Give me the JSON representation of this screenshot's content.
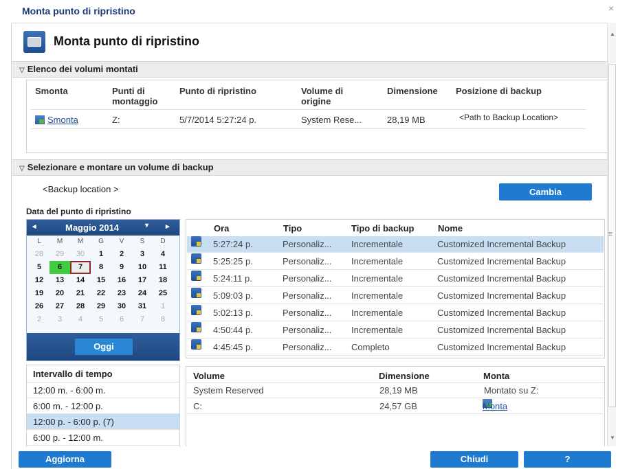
{
  "window": {
    "title": "Monta punto di ripristino",
    "close_glyph": "×"
  },
  "header": {
    "title": "Monta punto di ripristino",
    "icon": "mount-disk-icon"
  },
  "mounted_section": {
    "title": "Elenco dei volumi montati",
    "columns": [
      "Smonta",
      "Punti di\nmontaggio",
      "Punto di ripristino",
      "Volume di\norigine",
      "Dimensione",
      "Posizione di backup"
    ],
    "row": {
      "smonta": "Smonta",
      "mount_point": "Z:",
      "restore_point": "5/7/2014 5:27:24 p.",
      "source_volume": "System Rese...",
      "size": "28,19 MB",
      "backup_location": "<Path to Backup Location>"
    }
  },
  "select_section": {
    "title": "Selezionare e montare un volume di backup",
    "backup_location": "<Backup location >",
    "change_button": "Cambia",
    "date_label": "Data del punto di ripristino"
  },
  "calendar": {
    "month": "Maggio 2014",
    "prev": "◂",
    "next": "▸",
    "dropdown": "▾",
    "dow": [
      "L",
      "M",
      "M",
      "G",
      "V",
      "S",
      "D"
    ],
    "weeks": [
      [
        {
          "d": "28",
          "o": true
        },
        {
          "d": "29",
          "o": true
        },
        {
          "d": "30",
          "o": true
        },
        {
          "d": "1"
        },
        {
          "d": "2"
        },
        {
          "d": "3"
        },
        {
          "d": "4"
        }
      ],
      [
        {
          "d": "5"
        },
        {
          "d": "6",
          "g": true
        },
        {
          "d": "7",
          "s": true
        },
        {
          "d": "8"
        },
        {
          "d": "9"
        },
        {
          "d": "10"
        },
        {
          "d": "11"
        }
      ],
      [
        {
          "d": "12"
        },
        {
          "d": "13"
        },
        {
          "d": "14"
        },
        {
          "d": "15"
        },
        {
          "d": "16"
        },
        {
          "d": "17"
        },
        {
          "d": "18"
        }
      ],
      [
        {
          "d": "19"
        },
        {
          "d": "20"
        },
        {
          "d": "21"
        },
        {
          "d": "22"
        },
        {
          "d": "23"
        },
        {
          "d": "24"
        },
        {
          "d": "25"
        }
      ],
      [
        {
          "d": "26"
        },
        {
          "d": "27"
        },
        {
          "d": "28"
        },
        {
          "d": "29"
        },
        {
          "d": "30"
        },
        {
          "d": "31"
        },
        {
          "d": "1",
          "o": true
        }
      ],
      [
        {
          "d": "2",
          "o": true
        },
        {
          "d": "3",
          "o": true
        },
        {
          "d": "4",
          "o": true
        },
        {
          "d": "5",
          "o": true
        },
        {
          "d": "6",
          "o": true
        },
        {
          "d": "7",
          "o": true
        },
        {
          "d": "8",
          "o": true
        }
      ]
    ],
    "today_button": "Oggi"
  },
  "time_interval": {
    "title": "Intervallo di tempo",
    "items": [
      "12:00 m. - 6:00 m.",
      "6:00 m. - 12:00 p.",
      "12:00 p. - 6:00 p.  (7)",
      "6:00 p. - 12:00 m."
    ],
    "selected_index": 2
  },
  "recovery_points": {
    "columns": [
      "Ora",
      "Tipo",
      "Tipo di backup",
      "Nome"
    ],
    "rows": [
      {
        "time": "5:27:24 p.",
        "type": "Personaliz...",
        "backup_type": "Incrementale",
        "name": "Customized Incremental Backup"
      },
      {
        "time": "5:25:25 p.",
        "type": "Personaliz...",
        "backup_type": "Incrementale",
        "name": "Customized Incremental Backup"
      },
      {
        "time": "5:24:11 p.",
        "type": "Personaliz...",
        "backup_type": "Incrementale",
        "name": "Customized Incremental Backup"
      },
      {
        "time": "5:09:03 p.",
        "type": "Personaliz...",
        "backup_type": "Incrementale",
        "name": "Customized Incremental Backup"
      },
      {
        "time": "5:02:13 p.",
        "type": "Personaliz...",
        "backup_type": "Incrementale",
        "name": "Customized Incremental Backup"
      },
      {
        "time": "4:50:44 p.",
        "type": "Personaliz...",
        "backup_type": "Incrementale",
        "name": "Customized Incremental Backup"
      },
      {
        "time": "4:45:45 p.",
        "type": "Personaliz...",
        "backup_type": "Completo",
        "name": "Customized Incremental Backup"
      }
    ],
    "selected_index": 0
  },
  "volumes": {
    "columns": [
      "Volume",
      "Dimensione",
      "Monta"
    ],
    "rows": [
      {
        "volume": "System Reserved",
        "size": "28,19 MB",
        "mount": "Montato su Z:",
        "is_link": false
      },
      {
        "volume": "C:",
        "size": "24,57 GB",
        "mount": "Monta",
        "is_link": true
      }
    ]
  },
  "footer": {
    "refresh": "Aggiorna",
    "close": "Chiudi",
    "help": "?"
  },
  "colors": {
    "accent": "#1e7bd0",
    "title": "#1a3a78",
    "selection": "#c8dff3",
    "calendar_header": "#2f5e9b",
    "today_green": "#3fcc3f"
  }
}
